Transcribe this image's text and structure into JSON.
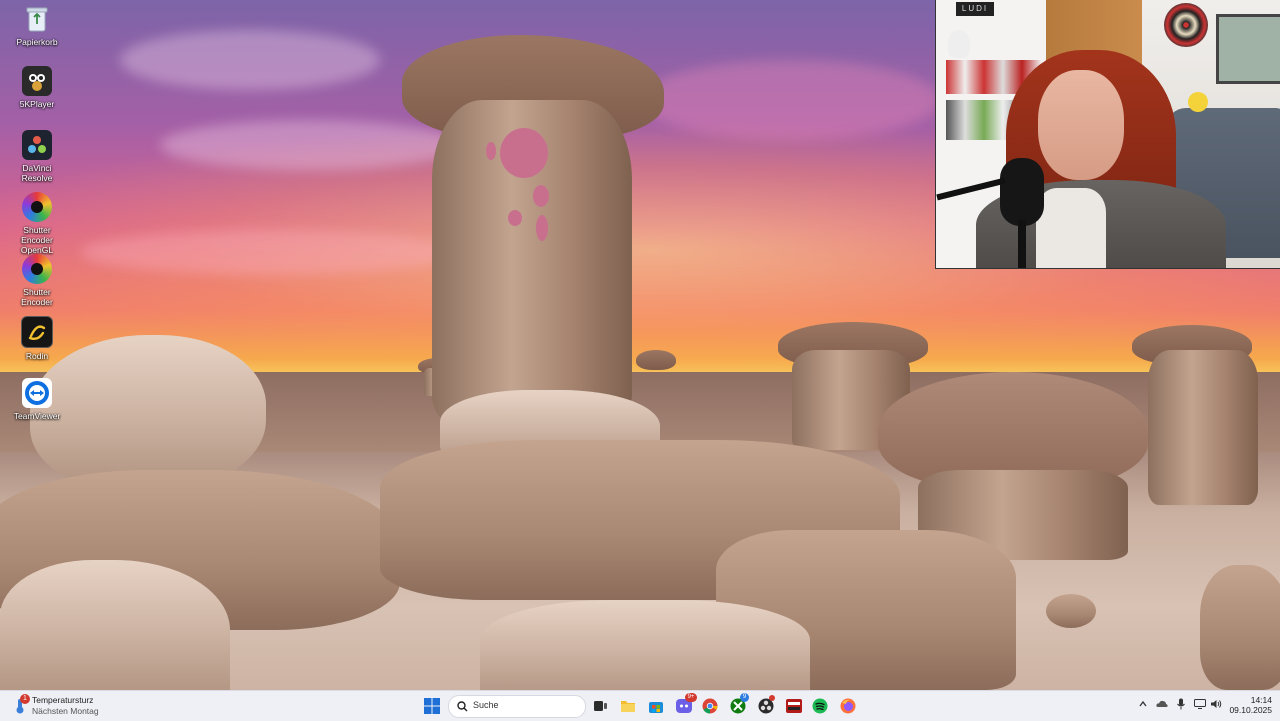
{
  "desktop_icons": [
    {
      "label": "Papierkorb",
      "icon": "recycle-bin-icon"
    },
    {
      "label": "5KPlayer",
      "icon": "5kplayer-icon"
    },
    {
      "label": "DaVinci Resolve",
      "icon": "davinci-resolve-icon"
    },
    {
      "label": "Shutter Encoder OpenGL",
      "icon": "shutter-encoder-icon"
    },
    {
      "label": "Shutter Encoder",
      "icon": "shutter-encoder-icon"
    },
    {
      "label": "Rodin",
      "icon": "rodin-icon"
    },
    {
      "label": "TeamViewer",
      "icon": "teamviewer-icon"
    }
  ],
  "webcam": {
    "sign_text": "LUDI",
    "description_icon": "webcam-overlay"
  },
  "taskbar": {
    "weather": {
      "title": "Temperatursturz",
      "subtitle": "Nächsten Montag",
      "badge": "1"
    },
    "search_placeholder": "Suche",
    "pinned_apps": [
      {
        "name": "start-menu-icon"
      },
      {
        "name": "search-icon"
      },
      {
        "name": "task-view-icon"
      },
      {
        "name": "file-explorer-icon"
      },
      {
        "name": "store-icon"
      },
      {
        "name": "discord-icon",
        "badge": "9+"
      },
      {
        "name": "chrome-icon"
      },
      {
        "name": "xbox-icon",
        "badge": "9"
      },
      {
        "name": "obs-icon"
      },
      {
        "name": "video-editor-icon"
      },
      {
        "name": "spotify-icon"
      },
      {
        "name": "firefox-icon"
      }
    ],
    "clock": {
      "time": "14:14",
      "date": "09.10.2025"
    }
  },
  "colors": {
    "taskbar_bg": "#eef0f5",
    "accent_blue": "#1f6fd6"
  }
}
